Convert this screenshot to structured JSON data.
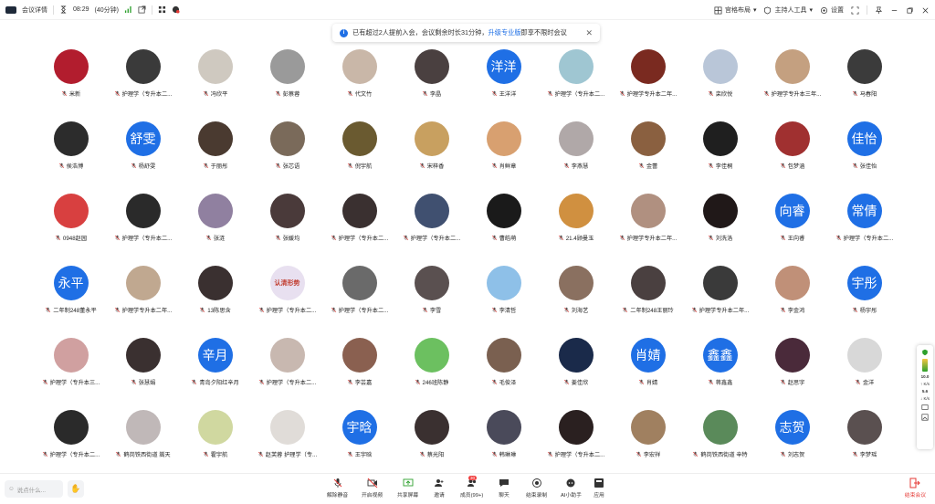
{
  "topbar": {
    "meeting_details": "会议详情",
    "time": "08:29",
    "duration": "(40分钟)",
    "layout_label": "宫格布局",
    "host_tools_label": "主持人工具",
    "settings_label": "设置"
  },
  "notice": {
    "text_before": "已有超过2人提前入会，会议剩余时长31分钟，",
    "link": "升级专业版",
    "text_after": "即享不限时会议"
  },
  "colors": {
    "accent": "#1f6fe5",
    "end_meeting": "#e53935",
    "avatar_blue": "#1f6fe5"
  },
  "participants": [
    {
      "name": "米新",
      "initials": "",
      "color": "#b21d2e"
    },
    {
      "name": "护理学（专升本二...",
      "initials": "",
      "color": "#3a3a3a"
    },
    {
      "name": "冯欣平",
      "initials": "",
      "color": "#cfc9c0"
    },
    {
      "name": "彭蔡蓉",
      "initials": "",
      "color": "#9a9a9a"
    },
    {
      "name": "代文竹",
      "initials": "",
      "color": "#c9b7a8"
    },
    {
      "name": "李晶",
      "initials": "",
      "color": "#4a4040"
    },
    {
      "name": "王洋洋",
      "initials": "洋洋",
      "color": "#1f6fe5"
    },
    {
      "name": "护理学（专升本二...",
      "initials": "",
      "color": "#9fc6d2"
    },
    {
      "name": "护理学专升本二年...",
      "initials": "",
      "color": "#7a2a20"
    },
    {
      "name": "栾欣悦",
      "initials": "",
      "color": "#b9c6d8"
    },
    {
      "name": "护理学专升本三年...",
      "initials": "",
      "color": "#c4a080"
    },
    {
      "name": "马春阳",
      "initials": "",
      "color": "#3b3b3b"
    },
    {
      "name": "侯浩博",
      "initials": "",
      "color": "#2c2c2c"
    },
    {
      "name": "杨舒雯",
      "initials": "舒雯",
      "color": "#1f6fe5"
    },
    {
      "name": "于丽彤",
      "initials": "",
      "color": "#4a3a30"
    },
    {
      "name": "张芯语",
      "initials": "",
      "color": "#7a6a5a"
    },
    {
      "name": "倪宇航",
      "initials": "",
      "color": "#6a5a30"
    },
    {
      "name": "宋梓香",
      "initials": "",
      "color": "#c8a060"
    },
    {
      "name": "肖鲜章",
      "initials": "",
      "color": "#d8a070"
    },
    {
      "name": "李燕慧",
      "initials": "",
      "color": "#b0a8a8"
    },
    {
      "name": "金蕾",
      "initials": "",
      "color": "#8a6040"
    },
    {
      "name": "李佳桐",
      "initials": "",
      "color": "#1f1f1f"
    },
    {
      "name": "包梦涵",
      "initials": "",
      "color": "#a03030"
    },
    {
      "name": "张佳怡",
      "initials": "佳怡",
      "color": "#1f6fe5"
    },
    {
      "name": "0948赵园",
      "initials": "",
      "color": "#d84040"
    },
    {
      "name": "护理学（专升本二...",
      "initials": "",
      "color": "#2a2a2a"
    },
    {
      "name": "张涟",
      "initials": "",
      "color": "#9080a0"
    },
    {
      "name": "张媛均",
      "initials": "",
      "color": "#4a3a3a"
    },
    {
      "name": "护理学（专升本二...",
      "initials": "",
      "color": "#3a3030"
    },
    {
      "name": "护理学（专升本二...",
      "initials": "",
      "color": "#405070"
    },
    {
      "name": "曹皓萌",
      "initials": "",
      "color": "#1a1a1a"
    },
    {
      "name": "21.4顾曼玉",
      "initials": "",
      "color": "#d09040"
    },
    {
      "name": "护理学专升本二年...",
      "initials": "",
      "color": "#b09080"
    },
    {
      "name": "刘洗洛",
      "initials": "",
      "color": "#201818"
    },
    {
      "name": "王向睿",
      "initials": "向睿",
      "color": "#1f6fe5"
    },
    {
      "name": "护理学（专升本二...",
      "initials": "常倩",
      "color": "#1f6fe5"
    },
    {
      "name": "二年制248董永平",
      "initials": "永平",
      "color": "#1f6fe5"
    },
    {
      "name": "护理学专升本二年...",
      "initials": "",
      "color": "#c0a890"
    },
    {
      "name": "13陈思含",
      "initials": "",
      "color": "#3a3030"
    },
    {
      "name": "护理学（专升本二...",
      "initials": "认清形势",
      "color": "#e8e0f0"
    },
    {
      "name": "护理学（专升本二...",
      "initials": "",
      "color": "#6a6a6a"
    },
    {
      "name": "李雪",
      "initials": "",
      "color": "#5a5050"
    },
    {
      "name": "李清哲",
      "initials": "",
      "color": "#8ec0e8"
    },
    {
      "name": "刘海艺",
      "initials": "",
      "color": "#8a7060"
    },
    {
      "name": "二年制248王丽玲",
      "initials": "",
      "color": "#4a4040"
    },
    {
      "name": "护理学专升本二年...",
      "initials": "",
      "color": "#3a3a3a"
    },
    {
      "name": "李金鸿",
      "initials": "",
      "color": "#c09078"
    },
    {
      "name": "杨宇彤",
      "initials": "宇彤",
      "color": "#1f6fe5"
    },
    {
      "name": "护理学（专升本三...",
      "initials": "",
      "color": "#d0a0a0"
    },
    {
      "name": "张慧娟",
      "initials": "",
      "color": "#3a3030"
    },
    {
      "name": "青岛夕阳红辛月",
      "initials": "辛月",
      "color": "#1f6fe5"
    },
    {
      "name": "护理学（专升本二...",
      "initials": "",
      "color": "#c8b8b0"
    },
    {
      "name": "李芸嘉",
      "initials": "",
      "color": "#8a6050"
    },
    {
      "name": "246班陈静",
      "initials": "",
      "color": "#6cc060"
    },
    {
      "name": "毛俊泽",
      "initials": "",
      "color": "#7a6050"
    },
    {
      "name": "姜佳欣",
      "initials": "",
      "color": "#1a2a4a"
    },
    {
      "name": "肖婧",
      "initials": "肖婧",
      "color": "#1f6fe5"
    },
    {
      "name": "蒋鑫鑫",
      "initials": "鑫鑫",
      "color": "#1f6fe5"
    },
    {
      "name": "赵思宇",
      "initials": "",
      "color": "#4a2a3a"
    },
    {
      "name": "金洋",
      "initials": "",
      "color": "#d8d8d8"
    },
    {
      "name": "护理学（专升本二...",
      "initials": "",
      "color": "#2a2a2a"
    },
    {
      "name": "鹤岗铁西街道 嵩天",
      "initials": "",
      "color": "#c0b8b8"
    },
    {
      "name": "霍宇航",
      "initials": "",
      "color": "#d0d8a0"
    },
    {
      "name": "赵芙蓉 护理学（专...",
      "initials": "",
      "color": "#e0dcd8"
    },
    {
      "name": "王宇晗",
      "initials": "宇晗",
      "color": "#1f6fe5"
    },
    {
      "name": "蔡光阳",
      "initials": "",
      "color": "#3a3030"
    },
    {
      "name": "韩琳琳",
      "initials": "",
      "color": "#4a4a5a"
    },
    {
      "name": "护理学（专升本二...",
      "initials": "",
      "color": "#2a2020"
    },
    {
      "name": "李宏祥",
      "initials": "",
      "color": "#a08060"
    },
    {
      "name": "鹤岗铁西街道 辛特",
      "initials": "",
      "color": "#5a8a5a"
    },
    {
      "name": "刘志贺",
      "initials": "志贺",
      "color": "#1f6fe5"
    },
    {
      "name": "李梦瑶",
      "initials": "",
      "color": "#5a5050"
    }
  ],
  "sidewidget": {
    "stat1": "10.0",
    "stat1_unit": "↑ K/s",
    "stat2": "5.6",
    "stat2_unit": "↓ K/s"
  },
  "bottombar": {
    "chat_placeholder": "说点什么...",
    "unmute": "解除静音",
    "start_video": "开启视频",
    "share_screen": "共享屏幕",
    "invite": "邀请",
    "members": "成员(99+)",
    "members_badge": "30",
    "chat": "聊天",
    "record": "结束录制",
    "ai_assistant": "AI小助手",
    "apps": "应用",
    "end_meeting": "结束会议"
  }
}
